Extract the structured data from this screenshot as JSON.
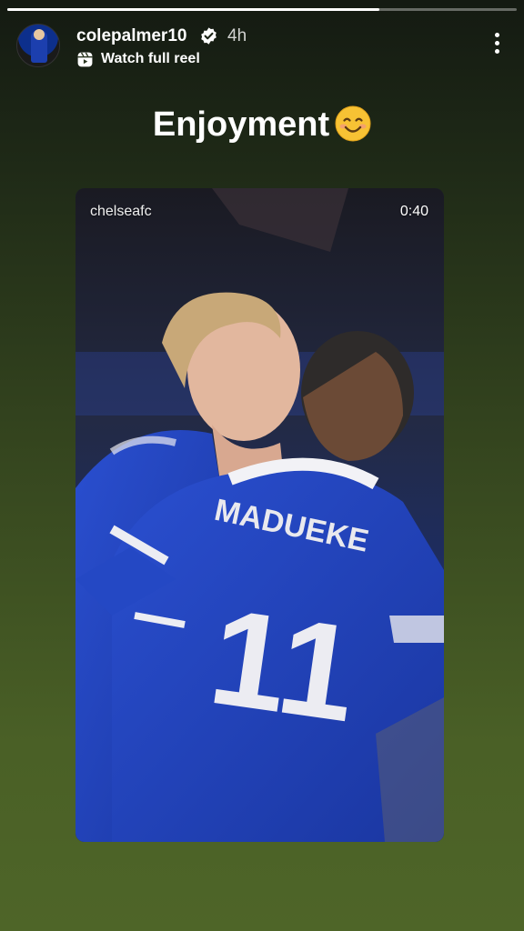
{
  "story": {
    "progress_fraction": 0.73,
    "username": "colepalmer10",
    "verified": true,
    "posted_ago": "4h",
    "reel_link_label": "Watch full reel",
    "caption": "Enjoyment",
    "caption_emoji": "smiling-face-emoji"
  },
  "video": {
    "author": "chelseafc",
    "duration": "0:40",
    "shirt_name": "MADUEKE",
    "shirt_number": "11"
  },
  "icons": {
    "verified": "verified-badge-icon",
    "reel": "reel-icon",
    "menu": "more-options-icon"
  },
  "colors": {
    "background_top": "#141a12",
    "background_bottom": "#4e6528",
    "verified_badge": "#ffffff",
    "kit_blue": "#1b3fb8"
  }
}
